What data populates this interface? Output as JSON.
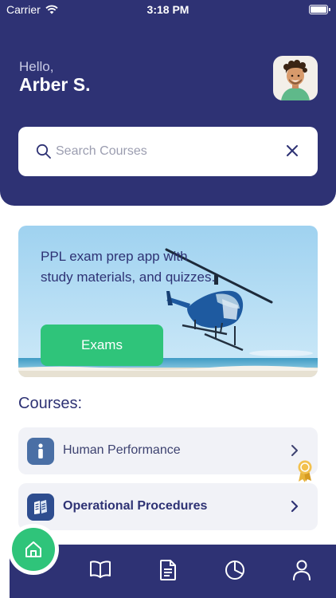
{
  "status_bar": {
    "carrier": "Carrier",
    "time": "3:18 PM"
  },
  "header": {
    "greeting": "Hello,",
    "user_name": "Arber S."
  },
  "search": {
    "placeholder": "Search Courses",
    "value": ""
  },
  "banner": {
    "text": "PPL exam prep app with study materials, and quizzes.",
    "button_label": "Exams"
  },
  "courses": {
    "title": "Courses:",
    "items": [
      {
        "label": "Human Performance",
        "icon": "person-icon",
        "icon_color": "#4a6fa5",
        "text_color": "#3d4270"
      },
      {
        "label": "Operational Procedures",
        "icon": "manual-icon",
        "icon_color": "#2e4d8f",
        "text_color": "#2e3274"
      }
    ]
  },
  "tab_bar": {
    "items": [
      "home-icon",
      "book-icon",
      "document-icon",
      "pie-chart-icon",
      "profile-icon"
    ]
  },
  "colors": {
    "primary": "#2e3274",
    "accent": "#2fc47a",
    "surface": "#f1f2f7",
    "badge": "#e8b43a"
  }
}
